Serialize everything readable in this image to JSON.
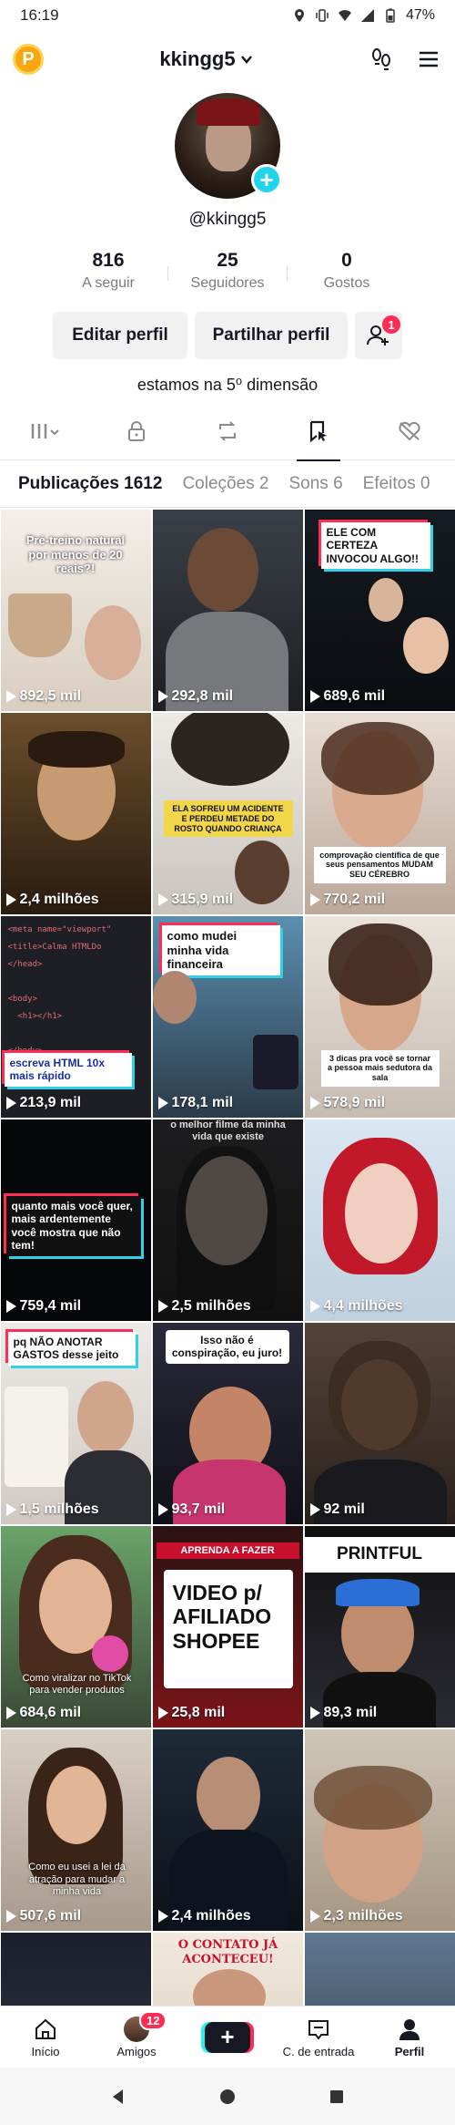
{
  "status_bar": {
    "time": "16:19",
    "battery": "47%"
  },
  "header": {
    "username": "kkingg5"
  },
  "profile": {
    "handle": "@kkingg5",
    "stats": [
      {
        "value": "816",
        "label": "A seguir"
      },
      {
        "value": "25",
        "label": "Seguidores"
      },
      {
        "value": "0",
        "label": "Gostos"
      }
    ],
    "edit_label": "Editar perfil",
    "share_label": "Partilhar perfil",
    "add_friends_badge": "1",
    "bio": "estamos na 5⁰ dimensão"
  },
  "content_tabs": [
    {
      "label": "Publicações 1612"
    },
    {
      "label": "Coleções 2"
    },
    {
      "label": "Sons 6"
    },
    {
      "label": "Efeitos 0"
    }
  ],
  "videos": [
    {
      "views": "892,5 mil",
      "caption": "Pré-treino natural por menos de 20 reais?!"
    },
    {
      "views": "292,8 mil",
      "caption": ""
    },
    {
      "views": "689,6 mil",
      "caption": "ELE COM CERTEZA INVOCOU ALGO!!"
    },
    {
      "views": "2,4 milhões",
      "caption": ""
    },
    {
      "views": "315,9 mil",
      "caption": "ELA SOFREU UM ACIDENTE E PERDEU METADE DO ROSTO QUANDO CRIANÇA"
    },
    {
      "views": "770,2 mil",
      "caption": "comprovação científica de que seus pensamentos MUDAM SEU CÉREBRO"
    },
    {
      "views": "213,9 mil",
      "caption": "escreva HTML 10x mais rápido"
    },
    {
      "views": "178,1 mil",
      "caption": "como mudei minha vida financeira"
    },
    {
      "views": "578,9 mil",
      "caption": "3 dicas pra você se tornar a pessoa mais sedutora da sala"
    },
    {
      "views": "759,4 mil",
      "caption": "quanto mais você quer, mais ardentemente você mostra que não tem!"
    },
    {
      "views": "2,5 milhões",
      "caption": "o melhor filme da minha vida que existe"
    },
    {
      "views": "4,4 milhões",
      "caption": ""
    },
    {
      "views": "1,5 milhões",
      "caption": "pq NÃO ANOTAR GASTOS desse jeito"
    },
    {
      "views": "93,7 mil",
      "caption": "Isso não é conspiração, eu juro!"
    },
    {
      "views": "92 mil",
      "caption": ""
    },
    {
      "views": "684,6 mil",
      "caption": "Como viralizar no TikTok para vender produtos"
    },
    {
      "views": "25,8 mil",
      "caption": "VIDEO p/ AFILIADO SHOPEE"
    },
    {
      "views": "89,3 mil",
      "caption": "PRINTFUL"
    },
    {
      "views": "507,6 mil",
      "caption": "Como eu usei a lei da atração para mudar a minha vida"
    },
    {
      "views": "2,4 milhões",
      "caption": ""
    },
    {
      "views": "2,3 milhões",
      "caption": ""
    },
    {
      "views": "",
      "caption": ""
    },
    {
      "views": "",
      "caption": "O CONTATO JÁ ACONTECEU!"
    },
    {
      "views": "",
      "caption": ""
    }
  ],
  "bottom_nav": [
    {
      "label": "Início"
    },
    {
      "label": "Amigos",
      "badge": "12"
    },
    {
      "label": ""
    },
    {
      "label": "C. de entrada"
    },
    {
      "label": "Perfil"
    }
  ],
  "colors": {
    "accent_red": "#fe2c55",
    "accent_cyan": "#20d5ec"
  }
}
